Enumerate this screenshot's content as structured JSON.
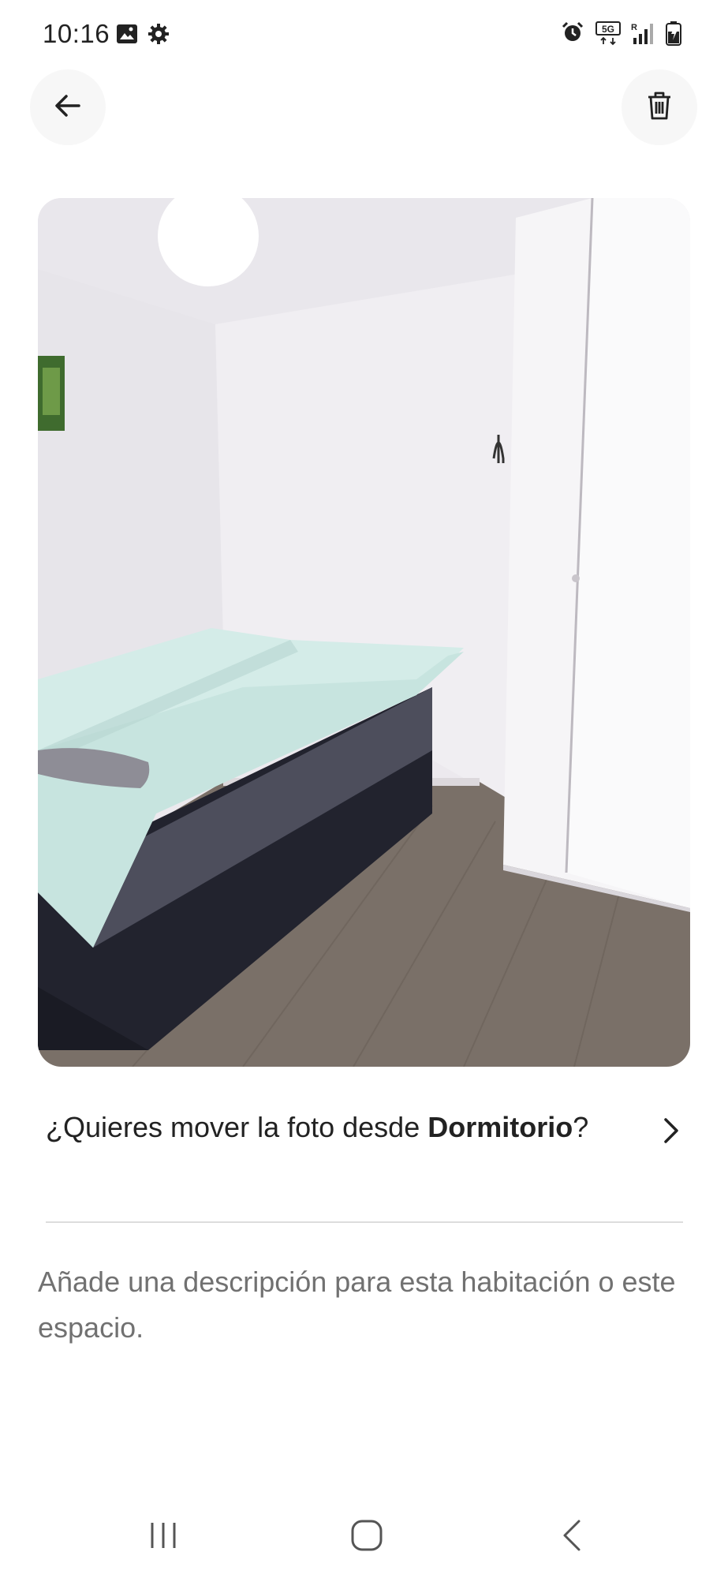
{
  "status_bar": {
    "time": "10:16",
    "left_icons": [
      "image-icon",
      "gear-icon"
    ],
    "right_icons": [
      "alarm-icon",
      "5g-icon",
      "signal-icon",
      "battery-icon"
    ],
    "network_label": "5G"
  },
  "header": {
    "back_icon": "arrow-left-icon",
    "delete_icon": "trash-icon"
  },
  "photo": {
    "subject": "bedroom"
  },
  "move_prompt": {
    "prefix": "¿Quieres mover la foto desde ",
    "room": "Dormitorio",
    "suffix": "?"
  },
  "description": {
    "placeholder": "Añade una descripción para esta habitación o este espacio."
  },
  "nav_bar": {
    "icons": [
      "recents-icon",
      "home-icon",
      "back-icon"
    ]
  },
  "colors": {
    "text_primary": "#222222",
    "text_secondary": "#717171",
    "button_bg": "#f7f7f7",
    "divider": "#dddddd"
  }
}
